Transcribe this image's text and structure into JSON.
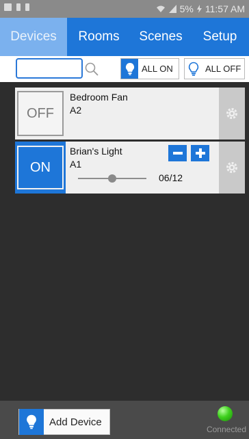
{
  "status_bar": {
    "battery": "5%",
    "time": "11:57 AM"
  },
  "nav": {
    "tabs": [
      {
        "label": "Devices",
        "active": true
      },
      {
        "label": "Rooms",
        "active": false
      },
      {
        "label": "Scenes",
        "active": false
      },
      {
        "label": "Setup",
        "active": false
      }
    ]
  },
  "toolbar": {
    "search_value": "",
    "all_on_label": "ALL ON",
    "all_off_label": "ALL OFF"
  },
  "devices": [
    {
      "name": "Bedroom Fan",
      "address": "A2",
      "state_label": "OFF",
      "on": false
    },
    {
      "name": "Brian's Light",
      "address": "A1",
      "state_label": "ON",
      "on": true,
      "level": "06/12",
      "level_fraction": 0.5
    }
  ],
  "bottom": {
    "add_device_label": "Add Device",
    "connection_status": "Connected"
  },
  "colors": {
    "accent": "#1e76d8",
    "active_tab": "#7bb1ee",
    "connected_led": "#3fd11e"
  },
  "icons": {
    "search": "search-icon",
    "bulb": "lightbulb-icon",
    "gear": "gear-icon",
    "minus": "minus-icon",
    "plus": "plus-icon"
  }
}
